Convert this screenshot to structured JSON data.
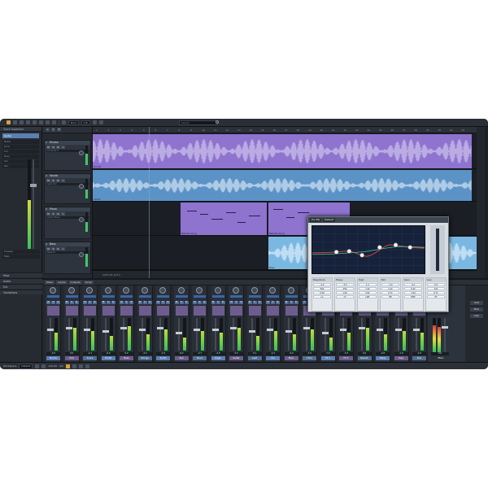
{
  "toolbar": {
    "mode_select": "Nool",
    "ratio_select": "1/8",
    "search_placeholder": "Search"
  },
  "inspector": {
    "header": "Track Inspector",
    "track_label": "Guitar",
    "rows": [
      "Nuter",
      "Orch",
      "Fcn",
      "Dlay",
      "Vol",
      "Pan"
    ],
    "output_label": "Presets",
    "output_value": "Main",
    "sections": [
      "Mixa",
      "Audio",
      "Ext",
      "Ossilations"
    ]
  },
  "arrange": {
    "tab_label": "Comusic Song.song",
    "ruler_ticks": [
      "1",
      "2",
      "3",
      "4",
      "5",
      "6",
      "7",
      "8",
      "9",
      "10",
      "11",
      "12",
      "13",
      "14",
      "15",
      "16",
      "17",
      "18",
      "19",
      "20",
      "21",
      "22",
      "23",
      "24",
      "25",
      "26",
      "27",
      "28",
      "29",
      "30",
      "31",
      "32"
    ],
    "tracks": [
      {
        "num": "1",
        "name": "Drums",
        "ctrl": [
          "M",
          "S",
          "R",
          "I"
        ],
        "mini": "Drum kit 1"
      },
      {
        "num": "2",
        "name": "Vocals",
        "ctrl": [
          "M",
          "S",
          "R",
          "I"
        ],
        "mini": "Lead Vox"
      },
      {
        "num": "3",
        "name": "Piano",
        "ctrl": [
          "M",
          "S",
          "R",
          "I"
        ],
        "mini": "Grand Piano"
      },
      {
        "num": "4",
        "name": "Bass",
        "ctrl": [
          "M",
          "S",
          "R",
          "I"
        ],
        "mini": "Bass DI"
      }
    ],
    "events": {
      "drums_label": "Drums",
      "vocals_label": "VocTS",
      "piano_label_1": "Melodie Song",
      "piano_label_2": "Melodie Song",
      "bass_label": "Bass"
    },
    "transport": "0003.03.123.0"
  },
  "plugin": {
    "title": "Pro EQ",
    "preset": "Default",
    "bands": [
      {
        "name": "Magnitude",
        "rows": [
          "-3.0",
          "500",
          "0.59",
          "LC"
        ]
      },
      {
        "name": "Phase",
        "rows": [
          "-3.0",
          "250",
          "1.00",
          "LF"
        ]
      },
      {
        "name": "High",
        "rows": [
          "1.1",
          "1.4k",
          "0.81",
          "LMF"
        ]
      },
      {
        "name": "Mid",
        "rows": [
          "-1.9",
          "2.1k",
          "0.71",
          "MF"
        ]
      },
      {
        "name": "Sens",
        "rows": [
          "4.4",
          "6.2k",
          "1.04",
          "HMF"
        ]
      },
      {
        "name": "Low",
        "rows": [
          "0.0",
          "12k",
          "0.71",
          "HF"
        ]
      }
    ]
  },
  "mixer": {
    "tabs": [
      "Mixer",
      "Inputs",
      "Outputs",
      "Small"
    ],
    "channels": [
      {
        "name": "Drums",
        "level": 0.55,
        "fader": 0.35,
        "value": "-4.5"
      },
      {
        "name": "Kick",
        "level": 0.7,
        "fader": 0.3,
        "value": "0.0"
      },
      {
        "name": "Snare",
        "level": 0.6,
        "fader": 0.35,
        "value": "-2.1"
      },
      {
        "name": "Hi-Hat",
        "level": 0.45,
        "fader": 0.4,
        "value": "-6.0"
      },
      {
        "name": "Bass",
        "level": 0.75,
        "fader": 0.3,
        "value": "0.0"
      },
      {
        "name": "Strings",
        "level": 0.5,
        "fader": 0.35,
        "value": "-3.4"
      },
      {
        "name": "Synth",
        "level": 0.65,
        "fader": 0.3,
        "value": "-1.0"
      },
      {
        "name": "Pad",
        "level": 0.4,
        "fader": 0.45,
        "value": "-8.2"
      },
      {
        "name": "Piano",
        "level": 0.6,
        "fader": 0.35,
        "value": "-2.7"
      },
      {
        "name": "Organ",
        "level": 0.55,
        "fader": 0.35,
        "value": "-3.0"
      },
      {
        "name": "Guitar",
        "level": 0.7,
        "fader": 0.3,
        "value": "0.0"
      },
      {
        "name": "Lead",
        "level": 0.45,
        "fader": 0.4,
        "value": "-5.1"
      },
      {
        "name": "Vox",
        "level": 0.6,
        "fader": 0.35,
        "value": "-2.2"
      },
      {
        "name": "BVox",
        "level": 0.5,
        "fader": 0.4,
        "value": "-4.0"
      },
      {
        "name": "Choir",
        "level": 0.65,
        "fader": 0.3,
        "value": "-1.5"
      },
      {
        "name": "FX 1",
        "level": 0.4,
        "fader": 0.45,
        "value": "-7.0"
      },
      {
        "name": "FX 2",
        "level": 0.55,
        "fader": 0.35,
        "value": "-3.3"
      },
      {
        "name": "Reverb",
        "level": 0.7,
        "fader": 0.3,
        "value": "0.0"
      },
      {
        "name": "Delay",
        "level": 0.5,
        "fader": 0.35,
        "value": "-2.8"
      },
      {
        "name": "Tape",
        "level": 0.6,
        "fader": 0.35,
        "value": "-1.9"
      },
      {
        "name": "Bus",
        "level": 0.55,
        "fader": 0.35,
        "value": "-2.4"
      }
    ],
    "master": {
      "name": "Main",
      "value": "0.0"
    },
    "side_buttons": [
      "Post",
      "Main",
      "Auto"
    ]
  },
  "status": {
    "workspace_label": "Workspace",
    "workspace_value": "Default",
    "tempo": "120.00",
    "signature": "4/4"
  },
  "colors": {
    "drums_event": "#8e73cf",
    "vocals_event": "#5b93c7",
    "piano_event": "#8e73cf",
    "bass_event": "#7ab8e2",
    "accent": "#d6a23a"
  }
}
